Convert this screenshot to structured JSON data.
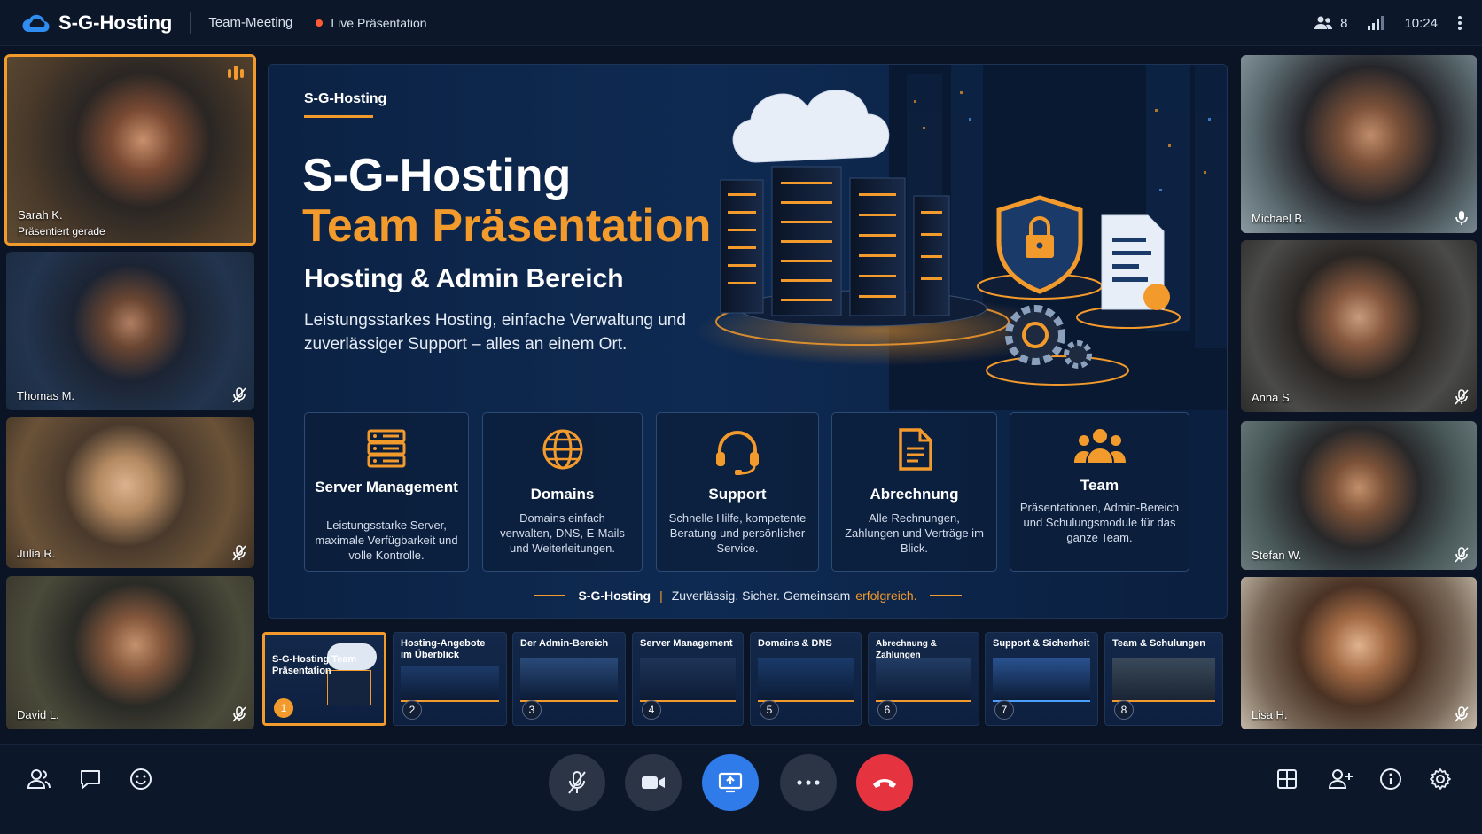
{
  "header": {
    "brand": "S-G-Hosting",
    "meeting_title": "Team-Meeting",
    "live_label": "Live Präsentation",
    "participant_count": "8",
    "time": "10:24"
  },
  "participants_left": [
    {
      "name": "Sarah K.",
      "status": "Präsentiert gerade",
      "speaking": true
    },
    {
      "name": "Thomas M.",
      "muted": true
    },
    {
      "name": "Julia R.",
      "muted": true
    },
    {
      "name": "David L.",
      "muted": true
    }
  ],
  "participants_right": [
    {
      "name": "Michael B.",
      "muted": false
    },
    {
      "name": "Anna S.",
      "muted": true
    },
    {
      "name": "Stefan W.",
      "muted": true
    },
    {
      "name": "Lisa H.",
      "muted": true
    }
  ],
  "slide": {
    "kicker": "S-G-Hosting",
    "title_line1": "S-G-Hosting",
    "title_line2": "Team Präsentation",
    "subtitle": "Hosting & Admin Bereich",
    "lead": "Leistungsstarkes Hosting, einfache Verwaltung und zuverlässiger Support – alles an einem Ort.",
    "cards": [
      {
        "icon": "server-icon",
        "title": "Server Management",
        "desc": "Leistungsstarke Server, maximale Verfügbarkeit und volle Kontrolle."
      },
      {
        "icon": "globe-icon",
        "title": "Domains",
        "desc": "Domains einfach verwalten, DNS, E-Mails und Weiterleitungen."
      },
      {
        "icon": "headset-icon",
        "title": "Support",
        "desc": "Schnelle Hilfe, kompetente Beratung und persönlicher Service."
      },
      {
        "icon": "document-icon",
        "title": "Abrechnung",
        "desc": "Alle Rechnungen, Zahlungen und Verträge im Blick."
      },
      {
        "icon": "team-icon",
        "title": "Team",
        "desc": "Präsentationen, Admin-Bereich und Schulungsmodule für das ganze Team."
      }
    ],
    "tagline_brand": "S-G-Hosting",
    "tagline_sep": "|",
    "tagline_text": "Zuverlässig. Sicher. Gemeinsam",
    "tagline_end": "erfolgreich."
  },
  "thumbnails": [
    {
      "number": "1",
      "label": "S-G-Hosting Team Präsentation",
      "selected": true
    },
    {
      "number": "2",
      "label": "Hosting-Angebote im Überblick"
    },
    {
      "number": "3",
      "label": "Der Admin-Bereich"
    },
    {
      "number": "4",
      "label": "Server Management"
    },
    {
      "number": "5",
      "label": "Domains & DNS"
    },
    {
      "number": "6",
      "label": "Abrechnung & Zahlungen"
    },
    {
      "number": "7",
      "label": "Support & Sicherheit"
    },
    {
      "number": "8",
      "label": "Team & Schulungen"
    }
  ],
  "colors": {
    "accent": "#f39a2c",
    "share_button": "#2f7bea",
    "end_call": "#e5333f",
    "background": "#0a1424"
  }
}
